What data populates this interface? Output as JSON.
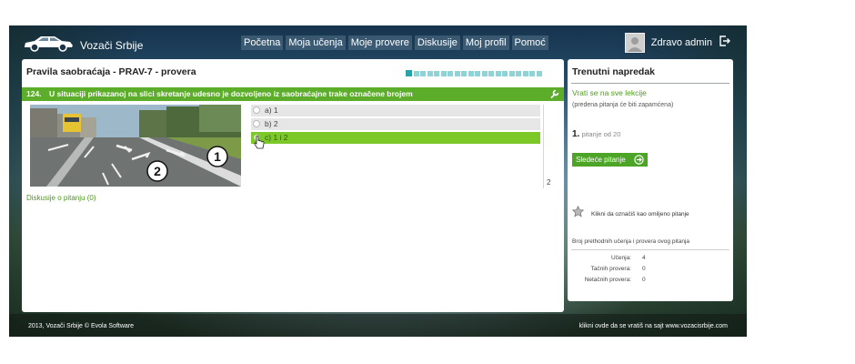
{
  "header": {
    "site_title": "Vozači Srbije",
    "nav": [
      "Početna",
      "Moja učenja",
      "Moje provere",
      "Diskusije",
      "Moj profil",
      "Pomoć"
    ],
    "greeting": "Zdravo admin",
    "icons": {
      "logo": "car-icon",
      "avatar": "user-avatar",
      "logout": "logout-icon"
    }
  },
  "test": {
    "title": "Pravila saobraćaja - PRAV-7 - provera",
    "progress": {
      "total": 20,
      "current": 1
    },
    "question": {
      "number": "124.",
      "text": "U situaciji prikazanoj na slici skretanje udesno je dozvoljeno iz saobraćajne trake označene brojem",
      "image_labels": [
        "1",
        "2"
      ],
      "answers": [
        {
          "label": "a) 1",
          "selected": false
        },
        {
          "label": "b) 2",
          "selected": false
        },
        {
          "label": "c) 1 i 2",
          "selected": true
        }
      ],
      "count": "2"
    },
    "discuss_link": "Diskusije o pitanju (0)"
  },
  "sidebar": {
    "title": "Trenutni napredak",
    "back_link": "Vrati se na sve lekcije",
    "saved_note": "(predena pitanja će biti zapamćena)",
    "counter_num": "1.",
    "counter_text": "pitanje od 20",
    "next_button": "Sledeće pitanje",
    "favorite_text": "Klikni da označiš kao omiljeno pitanje",
    "stats_title": "Broj prethodnih učenja i provera ovog pitanja",
    "stats": [
      {
        "label": "Učenja:",
        "value": "4"
      },
      {
        "label": "Tačnih provera:",
        "value": "0"
      },
      {
        "label": "Netačnih provera:",
        "value": "0"
      }
    ]
  },
  "footer": {
    "left": "2013, Vozači Srbije © Evola Software",
    "right": "klikni ovde da se vratiš na sajt  www.vozacisrbije.com"
  },
  "colors": {
    "accent_green": "#5cad2a",
    "selected_green": "#7cc829",
    "progress_teal": "#2aa3a8"
  }
}
